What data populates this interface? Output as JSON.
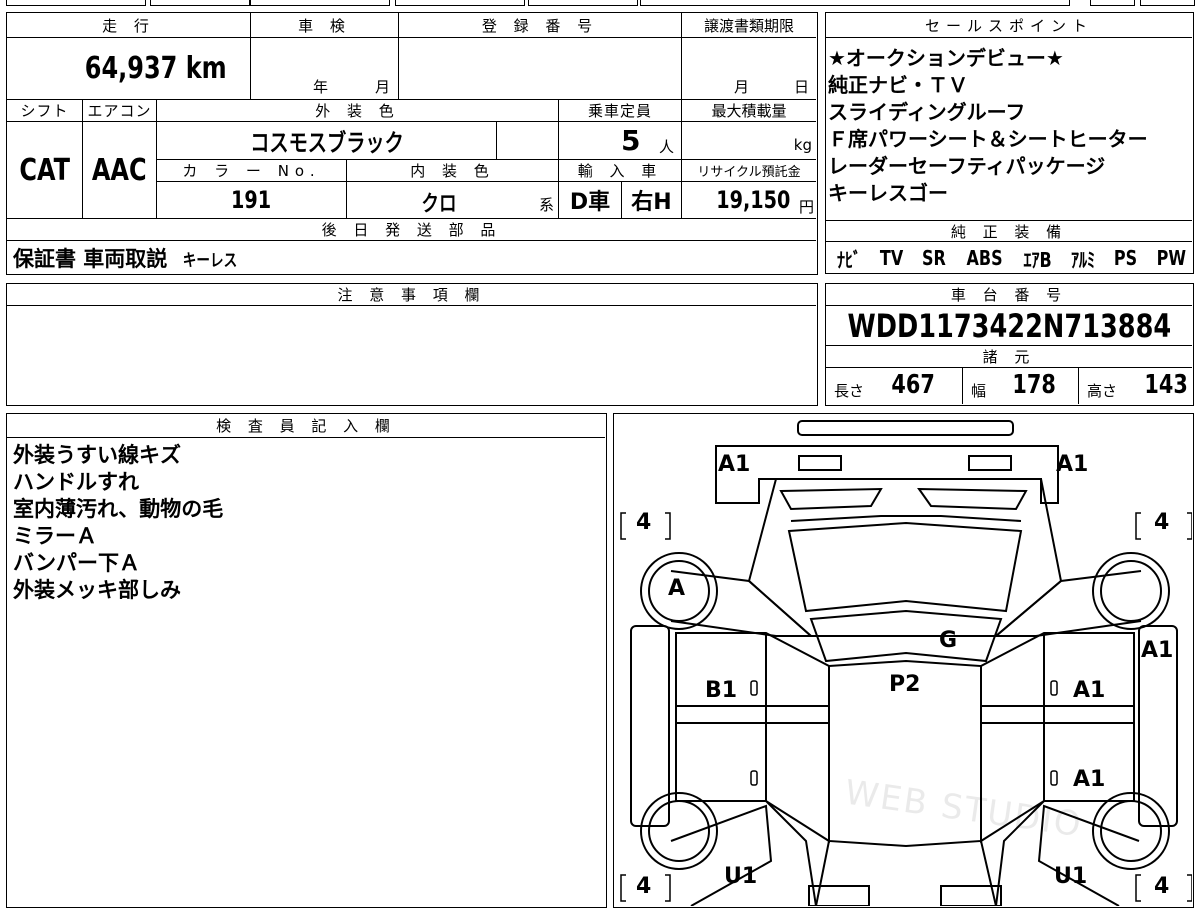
{
  "top_strip_partial": "",
  "vehicle": {
    "mileage_header": "走 行",
    "mileage": "64,937 km",
    "inspection_header": "車 検",
    "inspection_year": "年",
    "inspection_month": "月",
    "reg_header": "登 録 番 号",
    "transfer_header": "譲渡書類期限",
    "transfer_month": "月",
    "transfer_day": "日",
    "shift_header": "シフト",
    "shift": "CAT",
    "ac_header": "エアコン",
    "ac": "AAC",
    "exterior_header": "外 装 色",
    "exterior": "コスモスブラック",
    "capacity_header": "乗車定員",
    "capacity": "5",
    "capacity_unit": "人",
    "maxload_header": "最大積載量",
    "maxload_unit": "kg",
    "color_no_header": "カ ラ ー No.",
    "color_no": "191",
    "interior_header": "内 装 色",
    "interior": "クロ",
    "interior_suffix": "系",
    "import_header": "輸 入 車",
    "import_dealer": "D車",
    "steering": "右H",
    "recycle_header": "リサイクル預託金",
    "recycle": "19,150",
    "recycle_unit": "円",
    "later_parts_header": "後 日 発 送 部 品",
    "later_parts": "保証書 車両取説",
    "later_parts_small": "キーレス"
  },
  "sales": {
    "header": "セールスポイント",
    "lines": [
      "★オークションデビュー★",
      "純正ナビ・ＴＶ",
      "スライディングルーフ",
      "Ｆ席パワーシート＆シートヒーター",
      "レーダーセーフティパッケージ",
      "キーレスゴー"
    ],
    "equip_header": "純 正 装 備",
    "equipment": [
      "ﾅﾋﾞ",
      "TV",
      "SR",
      "ABS",
      "ｴｱB",
      "ｱﾙﾐ",
      "PS",
      "PW"
    ]
  },
  "notes": {
    "header": "注 意 事 項 欄",
    "text": ""
  },
  "chassis": {
    "header": "車 台 番 号",
    "number": "WDD1173422N713884",
    "specs_header": "諸 元",
    "length_label": "長さ",
    "length": "467",
    "width_label": "幅",
    "width": "178",
    "height_label": "高さ",
    "height": "143"
  },
  "inspector": {
    "header": "検 査 員 記 入 欄",
    "lines": [
      "外装うすい線キズ",
      "ハンドルすれ",
      "室内薄汚れ、動物の毛",
      "ミラーＡ",
      "バンパー下Ａ",
      "外装メッキ部しみ"
    ]
  },
  "diagram": {
    "labels": {
      "front_left": "A1",
      "front_right": "A1",
      "tire_fl": "4",
      "tire_fr": "4",
      "tire_rl": "4",
      "tire_rr": "4",
      "wheel_fl": "A",
      "hood": "G",
      "roof": "P2",
      "left_front_door": "B1",
      "right_front_door": "A1",
      "right_fender": "A1",
      "right_rear_door": "A1",
      "rear_left": "U1",
      "rear_right": "U1"
    },
    "watermark": "WEB STUDIO"
  }
}
